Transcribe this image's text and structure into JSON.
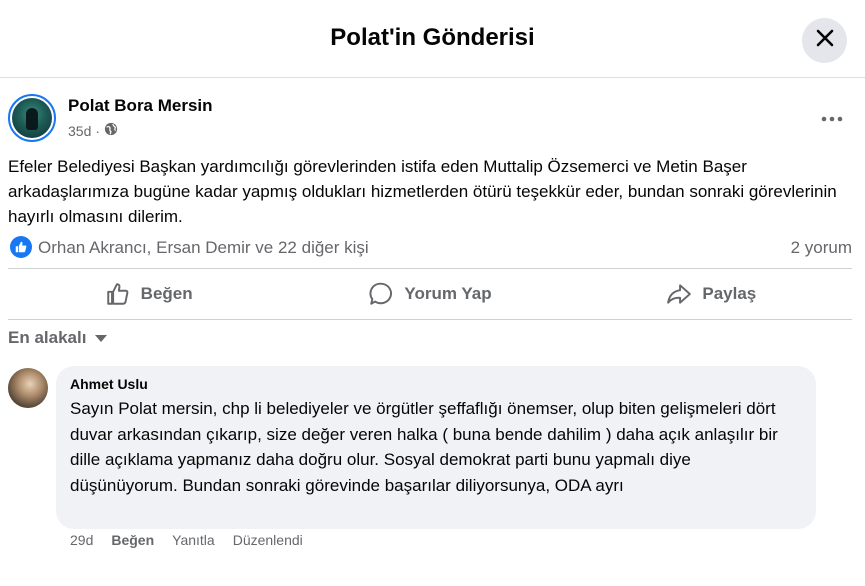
{
  "header": {
    "title": "Polat'in Gönderisi"
  },
  "post": {
    "author": "Polat Bora Mersin",
    "age": "35d",
    "separator": "·",
    "text": "Efeler Belediyesi Başkan yardımcılığı görevlerinden istifa eden Muttalip Özsemerci ve Metin Başer arkadaşlarımıza bugüne kadar yapmış oldukları hizmetlerden ötürü teşekkür eder, bundan sonraki görevlerinin hayırlı olmasını dilerim.",
    "reactions": "Orhan Akrancı, Ersan Demir ve 22 diğer kişi",
    "comments_count": "2 yorum"
  },
  "actions": {
    "like": "Beğen",
    "comment": "Yorum Yap",
    "share": "Paylaş"
  },
  "sort": {
    "label": "En alakalı"
  },
  "comment": {
    "author": "Ahmet Uslu",
    "text": "Sayın Polat mersin, chp li belediyeler ve örgütler şeffaflığı önemser, olup biten gelişmeleri dört duvar arkasından çıkarıp, size değer veren halka ( buna bende dahilim ) daha açık anlaşılır bir dille açıklama yapmanız daha doğru olur. Sosyal demokrat parti bunu yapmalı diye düşünüyorum. Bundan sonraki görevinde başarılar diliyorsunya, ODA ayrı",
    "age": "29d",
    "like": "Beğen",
    "reply": "Yanıtla",
    "edited": "Düzenlendi"
  },
  "icons": {
    "close": "close-icon",
    "globe": "globe-icon",
    "more": "more-horizontal-icon",
    "like_badge": "thumbs-up-icon",
    "like": "thumbs-up-icon",
    "comment": "speech-bubble-icon",
    "share": "share-arrow-icon",
    "sort": "caret-down-icon"
  },
  "colors": {
    "accent": "#1877f2",
    "secondary_text": "#65676b",
    "bubble_bg": "#f0f2f5"
  }
}
